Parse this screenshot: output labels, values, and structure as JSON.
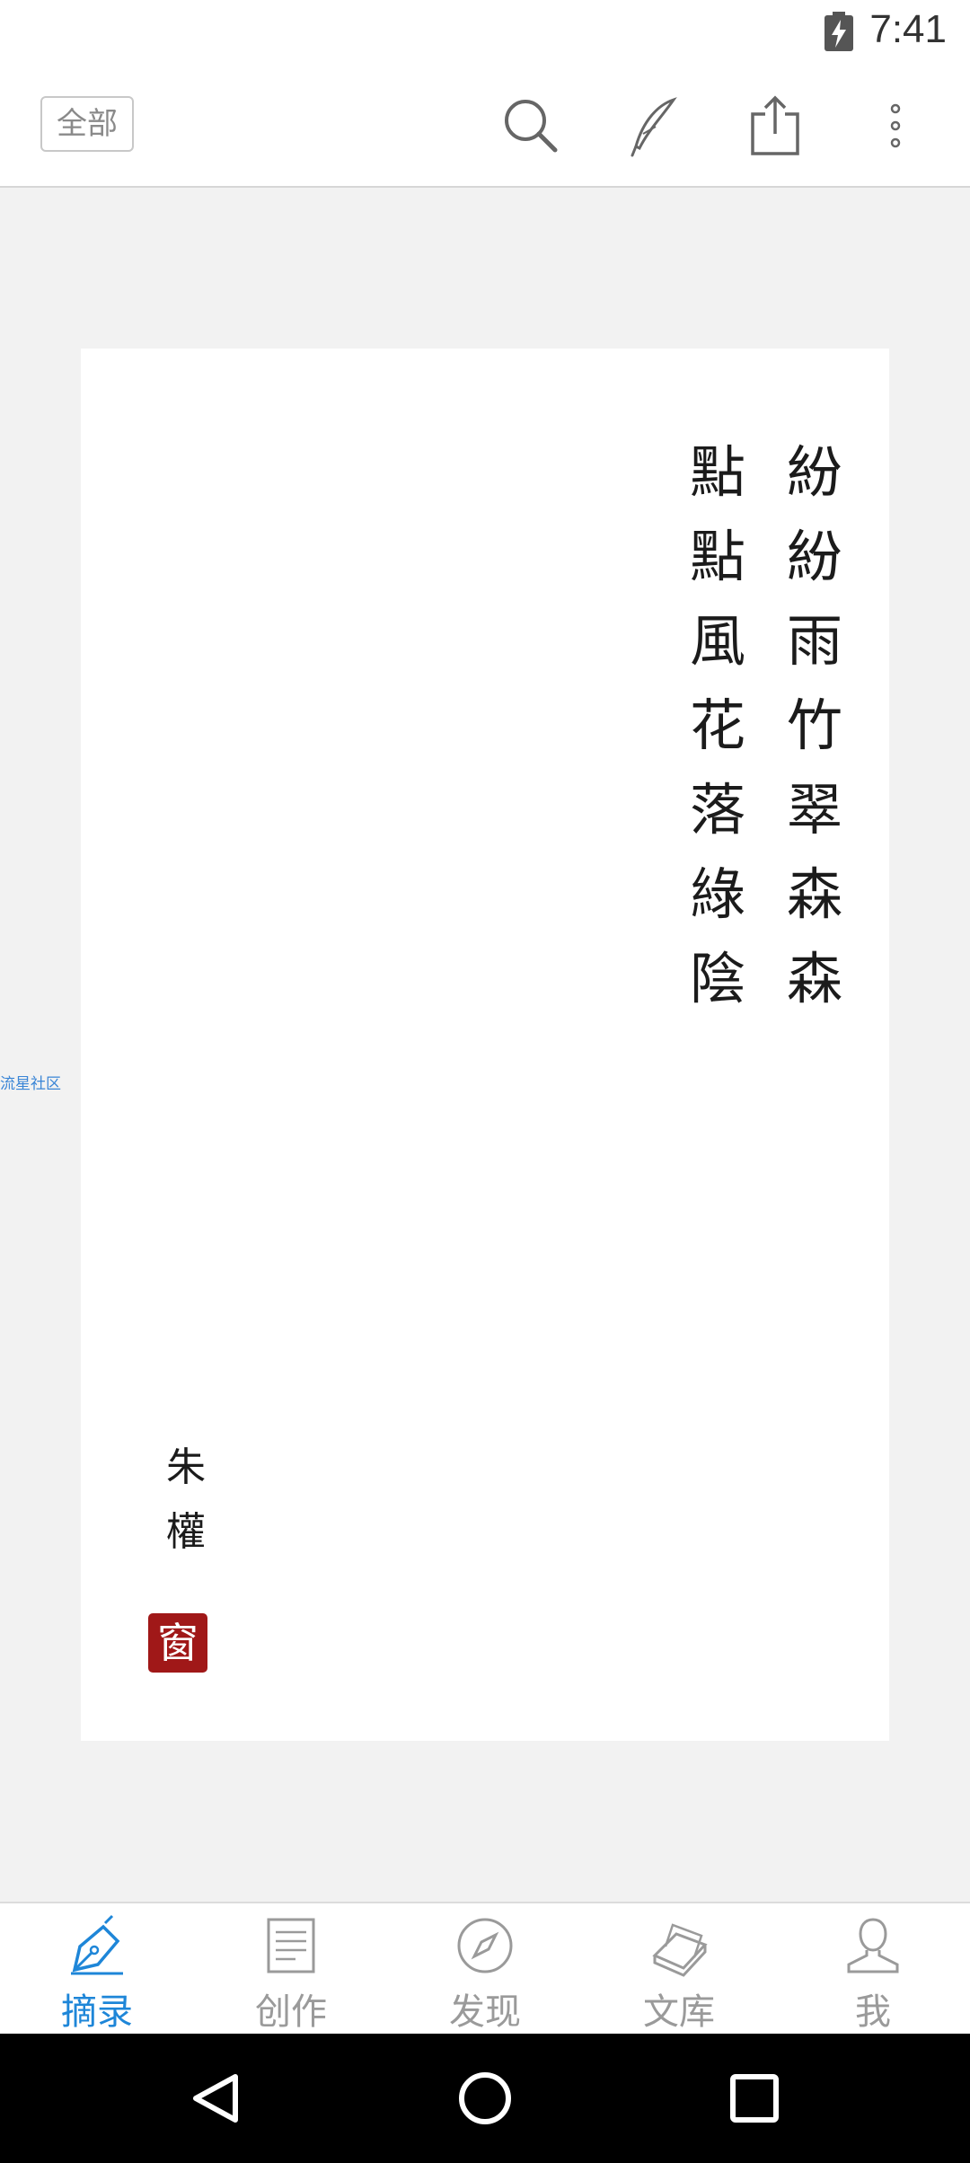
{
  "status_bar": {
    "time": "7:41",
    "battery_icon": "battery-charging-icon"
  },
  "toolbar": {
    "filter_label": "全部",
    "icons": [
      "search-icon",
      "quill-icon",
      "share-icon",
      "more-vert-icon"
    ]
  },
  "watermark": "流星社区",
  "poem": {
    "columns": [
      [
        "紛",
        "紛",
        "雨",
        "竹",
        "翠",
        "森",
        "森"
      ],
      [
        "點",
        "點",
        "風",
        "花",
        "落",
        "綠",
        "陰"
      ]
    ],
    "author": [
      "朱",
      "權"
    ],
    "seal": "窗"
  },
  "bottom_nav": [
    {
      "label": "摘录",
      "icon": "fountain-pen-icon",
      "active": true
    },
    {
      "label": "创作",
      "icon": "document-icon",
      "active": false
    },
    {
      "label": "发现",
      "icon": "compass-icon",
      "active": false
    },
    {
      "label": "文库",
      "icon": "books-icon",
      "active": false
    },
    {
      "label": "我",
      "icon": "person-icon",
      "active": false
    }
  ],
  "system_nav": [
    "back-icon",
    "home-icon",
    "recents-icon"
  ],
  "colors": {
    "accent": "#1e86d8",
    "seal": "#a01818",
    "background": "#f2f2f2"
  }
}
